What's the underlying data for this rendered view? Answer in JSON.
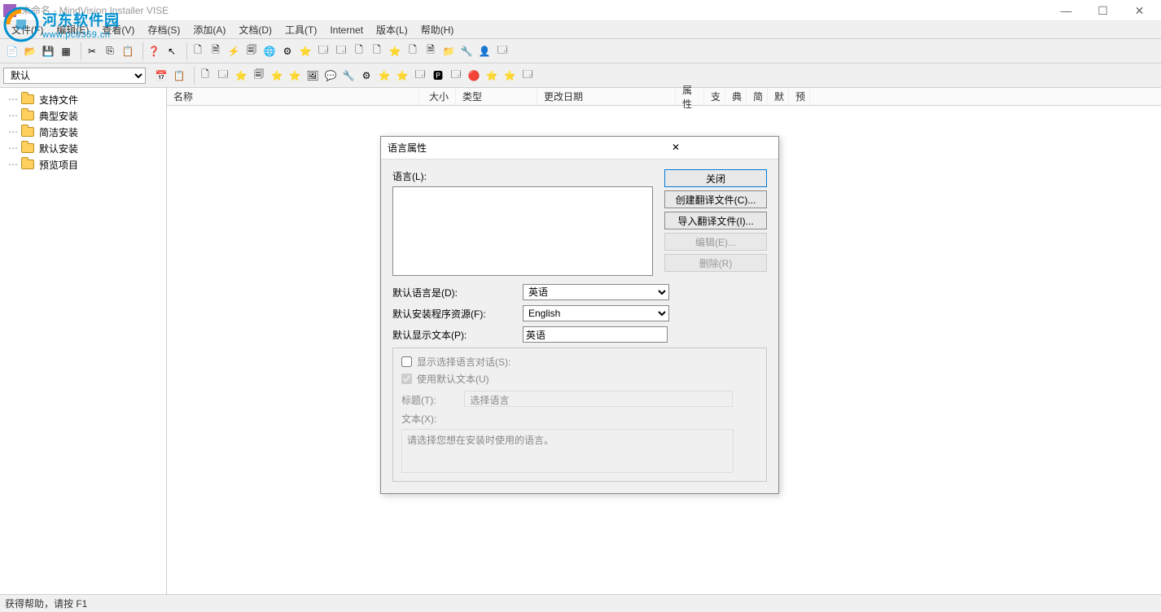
{
  "window": {
    "title": "未命名 - MindVision Installer VISE",
    "minimize": "—",
    "maximize": "☐",
    "close": "✕"
  },
  "menu": {
    "file": "文件(F)",
    "edit": "编辑(E)",
    "view": "查看(V)",
    "archive": "存档(S)",
    "add": "添加(A)",
    "doc": "文档(D)",
    "tool": "工具(T)",
    "internet": "Internet",
    "version": "版本(L)",
    "help": "帮助(H)"
  },
  "filter": {
    "default": "默认"
  },
  "tree": [
    {
      "label": "支持文件"
    },
    {
      "label": "典型安装"
    },
    {
      "label": "简洁安装"
    },
    {
      "label": "默认安装"
    },
    {
      "label": "预览项目"
    }
  ],
  "columns": {
    "name": "名称",
    "size": "大小",
    "type": "类型",
    "modified": "更改日期",
    "attr": "属性",
    "zhi": "支",
    "dian": "典",
    "jian": "简",
    "mo": "默",
    "yu": "预"
  },
  "status": "获得帮助，请按 F1",
  "watermark": {
    "cn": "河东软件园",
    "url": "www.pc0359.cn"
  },
  "dialog": {
    "title": "语言属性",
    "lang_label": "语言(L):",
    "close_btn": "关闭",
    "create_btn": "创建翻译文件(C)...",
    "import_btn": "导入翻译文件(I)...",
    "edit_btn": "编辑(E)...",
    "delete_btn": "删除(R)",
    "default_lang_label": "默认语言是(D):",
    "default_lang_value": "英语",
    "default_res_label": "默认安装程序资源(F):",
    "default_res_value": "English",
    "default_disp_label": "默认显示文本(P):",
    "default_disp_value": "英语",
    "show_dialog": "显示选择语言对话(S):",
    "use_default_text": "使用默认文本(U)",
    "title_label": "标题(T):",
    "title_value": "选择语言",
    "text_label": "文本(X):",
    "text_value": "请选择您想在安装时使用的语言。"
  }
}
